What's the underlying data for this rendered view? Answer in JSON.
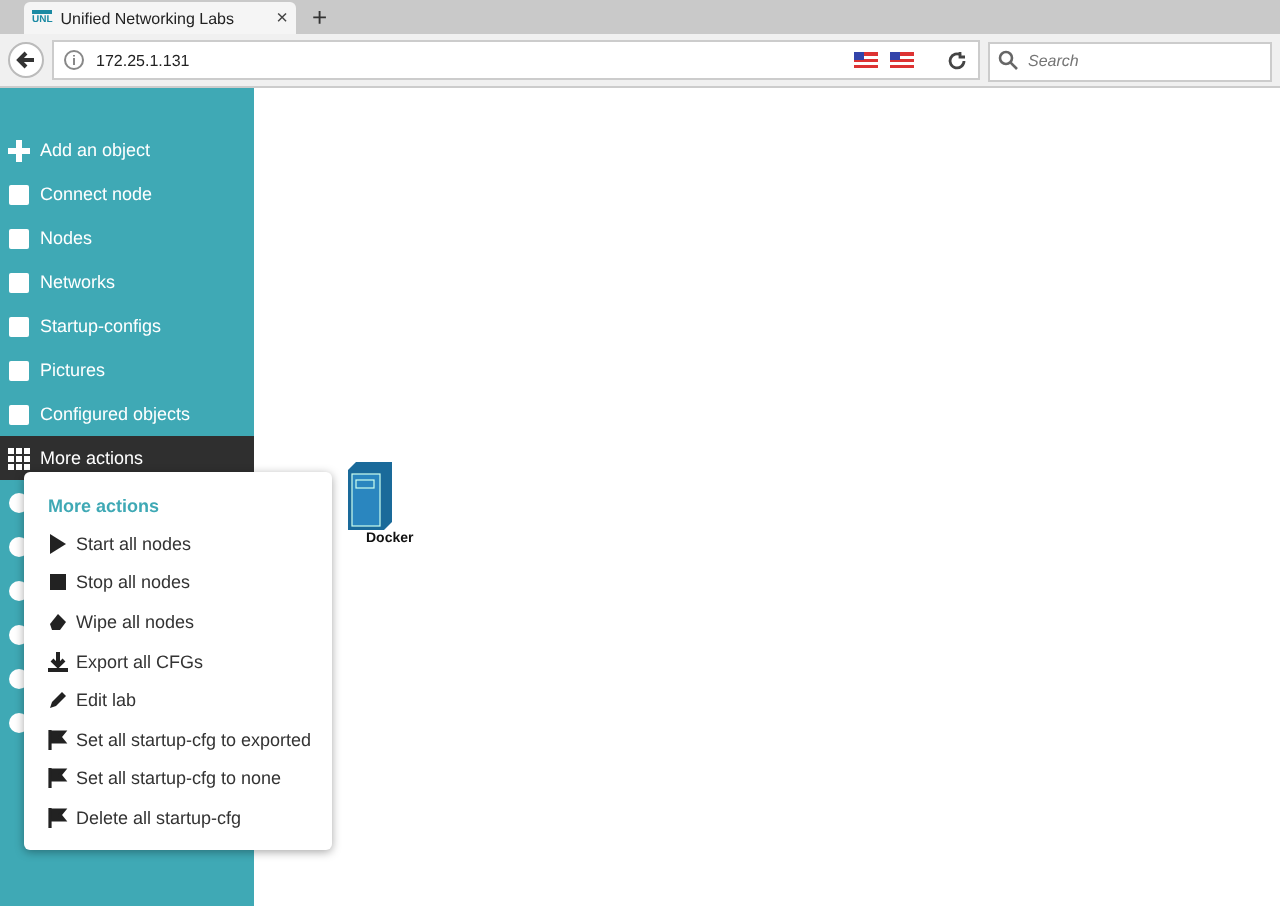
{
  "browser": {
    "tab_title": "Unified Networking Labs",
    "tab_logo": "UNL",
    "new_tab": "+",
    "close_tab": "×",
    "address": "172.25.1.131",
    "search": {
      "placeholder": "Search"
    }
  },
  "sidebar": {
    "items": [
      {
        "label": "Add an object",
        "selected": false
      },
      {
        "label": "Connect node",
        "selected": false
      },
      {
        "label": "Nodes",
        "selected": false
      },
      {
        "label": "Networks",
        "selected": false
      },
      {
        "label": "Startup-configs",
        "selected": false
      },
      {
        "label": "Pictures",
        "selected": false
      },
      {
        "label": "Configured objects",
        "selected": false
      },
      {
        "label": "More actions",
        "selected": true
      }
    ]
  },
  "canvas": {
    "nodes": [
      {
        "label": "Docker"
      }
    ]
  },
  "menu": {
    "title": "More actions",
    "items": [
      {
        "label": "Start all nodes"
      },
      {
        "label": "Stop all nodes"
      },
      {
        "label": "Wipe all nodes"
      },
      {
        "label": "Export all CFGs"
      },
      {
        "label": "Edit lab"
      },
      {
        "label": "Set all startup-cfg to exported"
      },
      {
        "label": "Set all startup-cfg to none"
      },
      {
        "label": "Delete all startup-cfg"
      }
    ]
  }
}
